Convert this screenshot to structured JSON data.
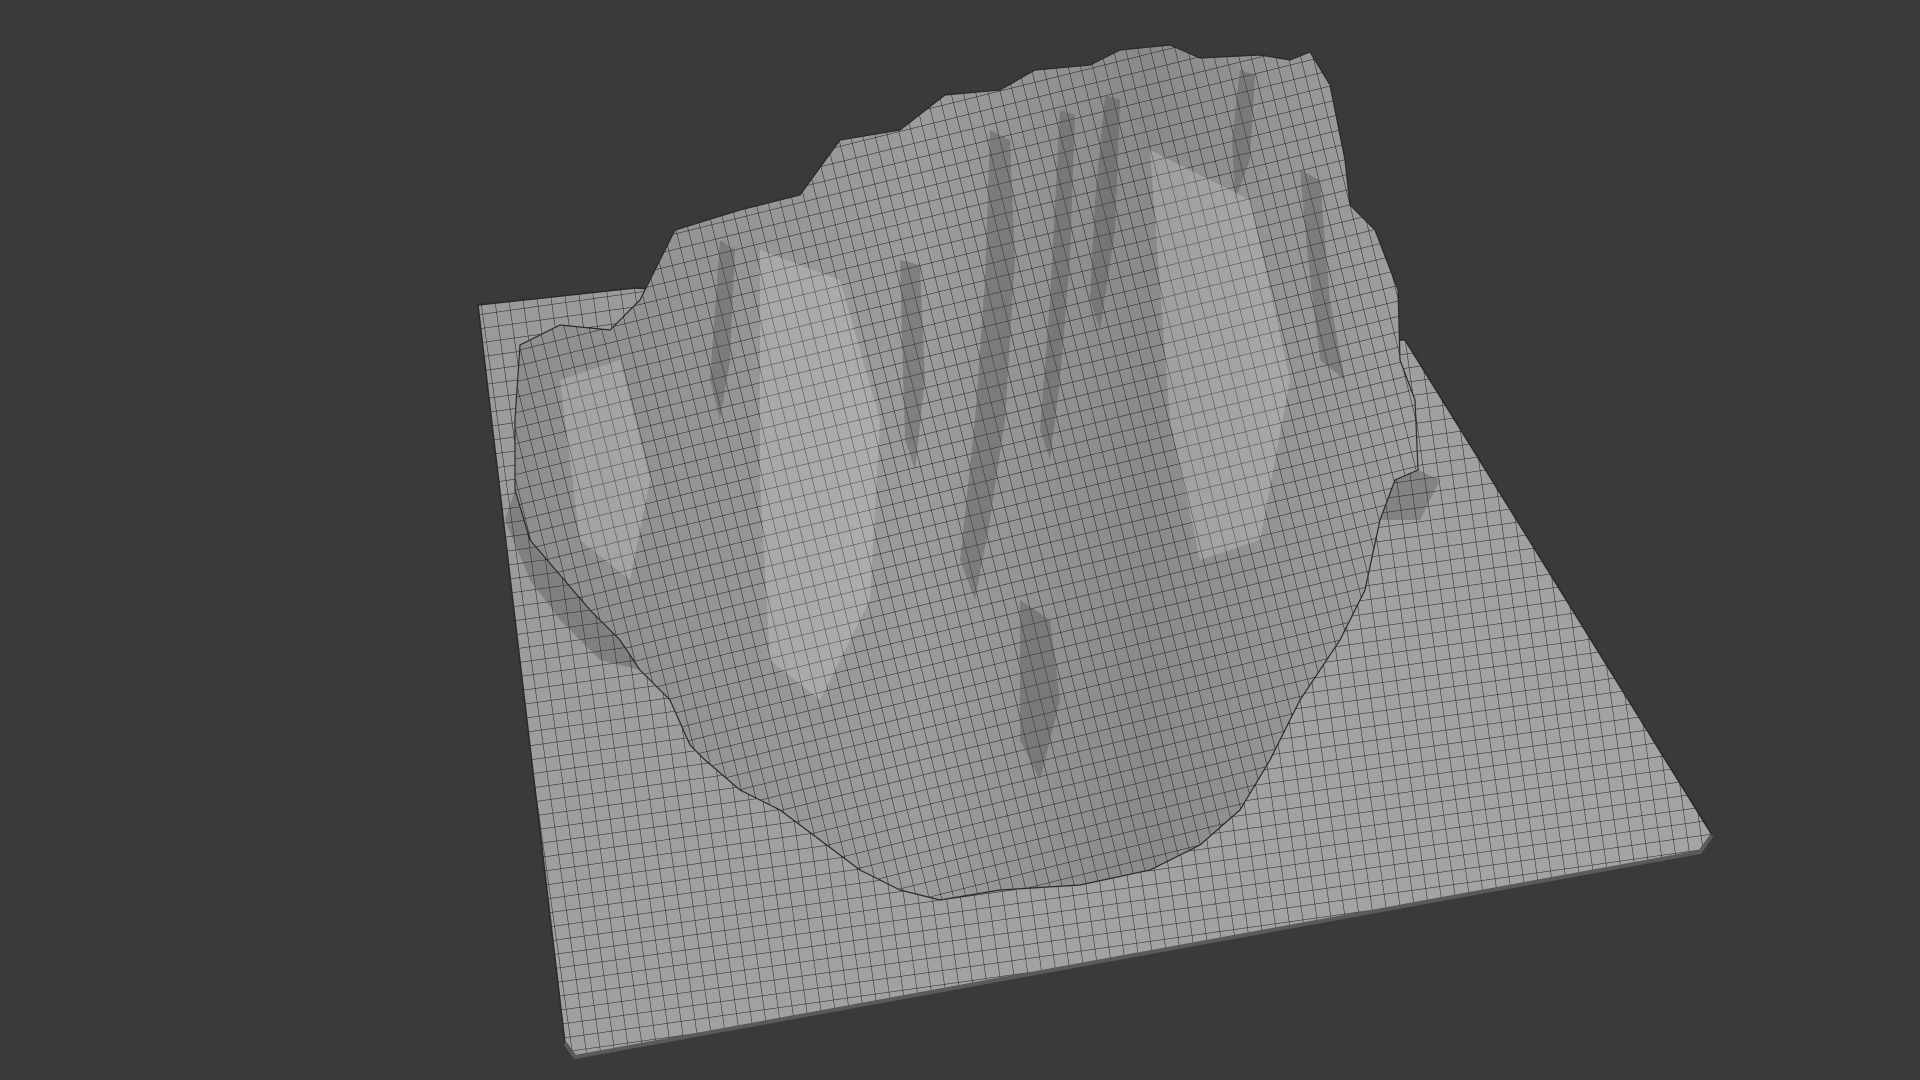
{
  "viewport": {
    "background_color": "#3a3a3a",
    "shading": "solid-gray-with-wireframe",
    "mesh_color": "#9d9d9d",
    "wire_color": "#1e1e1e",
    "object": "rock-terrain-mesh"
  }
}
